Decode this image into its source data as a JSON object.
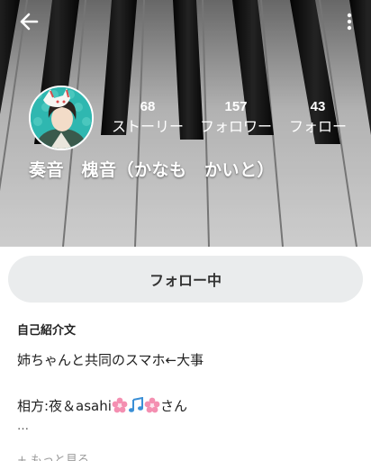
{
  "header": {
    "back_icon": "arrow-left-icon",
    "menu_icon": "more-vert-icon",
    "background": "piano-keys-cover-image"
  },
  "profile": {
    "avatar": "anime-character-with-fox-mask",
    "display_name": "奏音　槐音（かなも　かいと）"
  },
  "stats": {
    "stories": {
      "count": "68",
      "label": "ストーリー"
    },
    "followers": {
      "count": "157",
      "label": "フォロワー"
    },
    "following": {
      "count": "43",
      "label": "フォロー"
    }
  },
  "actions": {
    "follow_button_label": "フォロー中"
  },
  "bio": {
    "heading": "自己紹介文",
    "line1": "姉ちゃんと共同のスマホ←大事",
    "line2_prefix": "相方:夜＆asahi",
    "line2_suffix": "さん",
    "line2_icons": [
      "cherry-blossom-icon",
      "music-note-icon",
      "cherry-blossom-icon"
    ],
    "ellipsis": "…",
    "more_link": "+ もっと見る"
  },
  "colors": {
    "accent": "#3a8fd6",
    "button_bg": "#eaeced",
    "blossom": "#f48fb1",
    "note": "#3a8fd6"
  }
}
